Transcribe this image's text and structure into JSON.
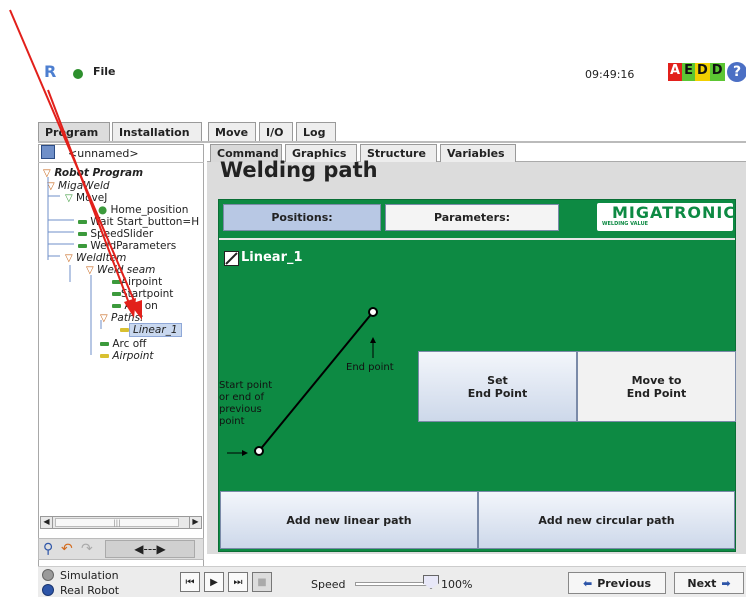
{
  "header": {
    "file_label": "File",
    "clock": "09:49:16",
    "aedd": [
      "A",
      "E",
      "D",
      "D"
    ],
    "help": "?"
  },
  "main_tabs": [
    "Program",
    "Installation",
    "Move",
    "I/O",
    "Log"
  ],
  "program_name": "<unnamed>",
  "tree": {
    "root": "Robot Program",
    "items": [
      "MigaWeld",
      "MoveJ",
      "Home_position",
      "Wait Start_button=H",
      "SpeedSlider",
      "WeldParameters",
      "WeldItem",
      "Weld seam",
      "Airpoint",
      "Startpoint",
      "Arc on",
      "Paths:",
      "Linear_1",
      "Arc off",
      "Airpoint"
    ]
  },
  "scroll_thumb": "|||",
  "sub_tabs": [
    "Command",
    "Graphics",
    "Structure",
    "Variables"
  ],
  "page": {
    "title": "Welding path",
    "positions_label": "Positions:",
    "parameters_label": "Parameters:",
    "brand_main": "MIGATRONIC",
    "brand_sub": "WELDING VALUE",
    "path_name": "Linear_1",
    "start_label": [
      "Start point",
      "or end of",
      "previous",
      "point"
    ],
    "end_label": "End point",
    "set_end": [
      "Set",
      "End Point"
    ],
    "move_end": [
      "Move to",
      "End Point"
    ],
    "add_linear": "Add new linear path",
    "add_circular": "Add new circular path"
  },
  "footer": {
    "simulation": "Simulation",
    "real_robot": "Real Robot",
    "speed_label": "Speed",
    "speed_value": "100%",
    "previous": "Previous",
    "next": "Next"
  }
}
